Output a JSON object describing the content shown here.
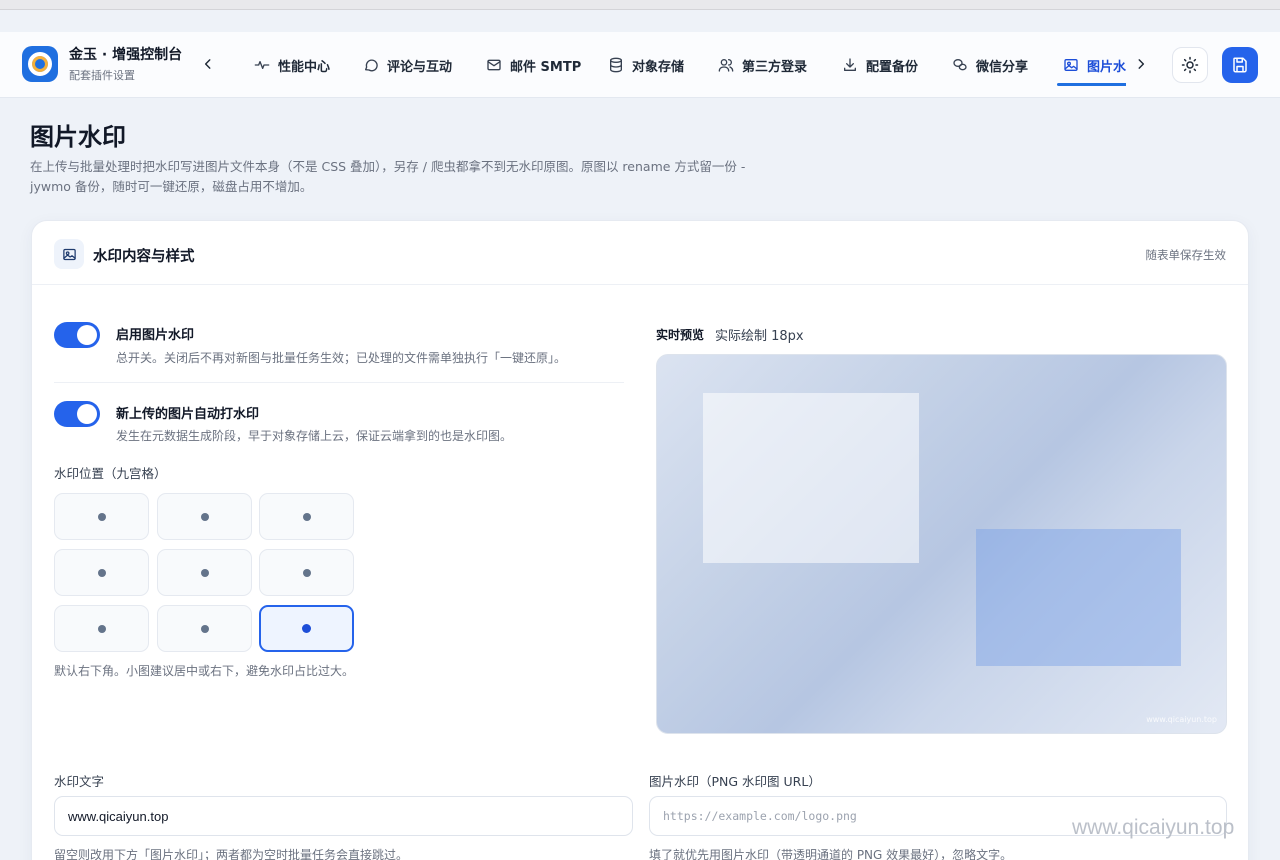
{
  "brand": {
    "title": "金玉 · 增强控制台",
    "subtitle": "配套插件设置"
  },
  "nav": {
    "tabs": [
      {
        "label": "性能中心",
        "icon": "activity-icon"
      },
      {
        "label": "评论与互动",
        "icon": "chat-bubble-icon"
      },
      {
        "label": "邮件 SMTP",
        "icon": "mail-icon"
      },
      {
        "label": "对象存储",
        "icon": "database-icon"
      },
      {
        "label": "第三方登录",
        "icon": "users-icon"
      },
      {
        "label": "配置备份",
        "icon": "download-icon"
      },
      {
        "label": "微信分享",
        "icon": "wechat-icon"
      },
      {
        "label": "图片水印",
        "icon": "image-icon",
        "active": true
      }
    ]
  },
  "page": {
    "title": "图片水印",
    "description": "在上传与批量处理时把水印写进图片文件本身（不是 CSS 叠加），另存 / 爬虫都拿不到无水印原图。原图以 rename 方式留一份 -jywmo 备份，随时可一键还原，磁盘占用不增加。"
  },
  "card": {
    "title": "水印内容与样式",
    "note": "随表单保存生效",
    "enable": {
      "title": "启用图片水印",
      "desc": "总开关。关闭后不再对新图与批量任务生效；已处理的文件需单独执行「一键还原」。",
      "on": true
    },
    "auto": {
      "title": "新上传的图片自动打水印",
      "desc": "发生在元数据生成阶段，早于对象存储上云，保证云端拿到的也是水印图。",
      "on": true
    },
    "position": {
      "label": "水印位置（九宫格）",
      "selected": "bottom-right",
      "hint": "默认右下角。小图建议居中或右下，避免水印占比过大。"
    },
    "preview": {
      "label": "实时预览",
      "size_text": "实际绘制 18px",
      "watermark_text": "www.qicaiyun.top"
    },
    "text_field": {
      "label": "水印文字",
      "value": "www.qicaiyun.top",
      "hint": "留空则改用下方「图片水印」；两者都为空时批量任务会直接跳过。"
    },
    "image_field": {
      "label": "图片水印（PNG 水印图 URL）",
      "placeholder": "https://example.com/logo.png",
      "hint": "填了就优先用图片水印（带透明通道的 PNG 效果最好），忽略文字。"
    }
  },
  "site_watermark": "www.qicaiyun.top",
  "colors": {
    "accent": "#2563eb",
    "background": "#eef2f8",
    "card": "#ffffff"
  }
}
